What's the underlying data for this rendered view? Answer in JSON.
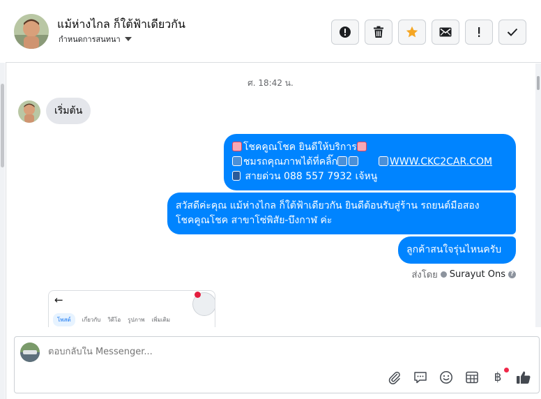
{
  "header": {
    "name": "แม้ห่างไกล ก็ใต้ฟ้าเดียวกัน",
    "assign_label": "กำหนดการสนทนา",
    "actions": [
      {
        "icon": "alert-icon",
        "label": "Mark as spam"
      },
      {
        "icon": "trash-icon",
        "label": "Delete"
      },
      {
        "icon": "star-icon",
        "label": "Star"
      },
      {
        "icon": "mail-icon",
        "label": "Mark unread"
      },
      {
        "icon": "exclamation-icon",
        "label": "Follow up"
      },
      {
        "icon": "check-icon",
        "label": "Mark done"
      }
    ]
  },
  "chat": {
    "timestamp": "ศ. 18:42 น.",
    "incoming": {
      "text": "เริ่มต้น"
    },
    "outgoing": [
      {
        "line1": "โชคคูณโชค ยินดีให้บริการ",
        "line2_prefix": "ชมรถคุณภาพได้ที่คลิ๊ก",
        "line2_link": "WWW.CKC2CAR.COM",
        "line3": "สายด่วน 088 557 7932 เจ้หนู"
      },
      {
        "line1": "สวัสดีค่ะคุณ แม้ห่างไกล ก็ใต้ฟ้าเดียวกัน ยินดีต้อนรับสู่ร้าน รถยนต์มือสอง",
        "line2": "โชคคูณโชค สาขาโซ่พิสัย-บึงกาฬ ค่ะ"
      },
      {
        "text": "ลูกค้าสนใจรุ่นไหนครับ"
      }
    ],
    "sent_by_prefix": "ส่งโดย",
    "sent_by_name": "Surayut Ons",
    "preview": {
      "tabs": [
        "โพสต์",
        "เกี่ยวกับ",
        "วิดีโอ",
        "รูปภาพ",
        "เพิ่มเติม"
      ]
    }
  },
  "composer": {
    "placeholder": "ตอบกลับใน Messenger...",
    "tools": [
      "paperclip-icon",
      "saved-reply-icon",
      "emoji-icon",
      "template-icon",
      "payment-icon",
      "like-icon"
    ],
    "payment_symbol": "฿"
  },
  "colors": {
    "accent": "#0084ff",
    "incoming_bubble": "#e4e6eb",
    "star": "#f5a623"
  }
}
